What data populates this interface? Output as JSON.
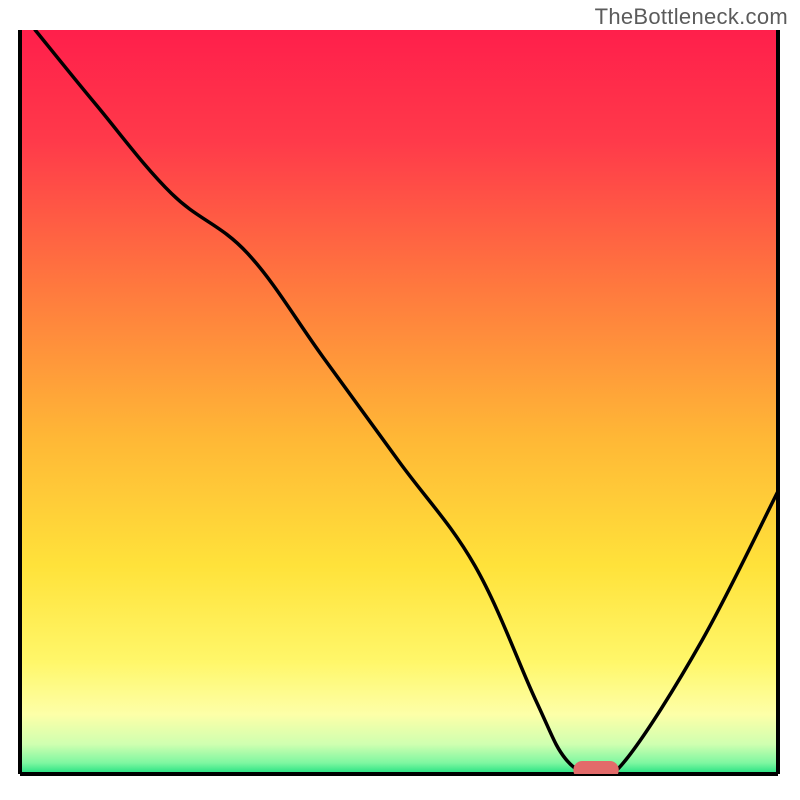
{
  "watermark": "TheBottleneck.com",
  "chart_data": {
    "type": "line",
    "title": "",
    "xlabel": "",
    "ylabel": "",
    "xlim": [
      0,
      100
    ],
    "ylim": [
      0,
      100
    ],
    "grid": false,
    "series": [
      {
        "name": "bottleneck-curve",
        "x": [
          2,
          10,
          20,
          30,
          40,
          50,
          60,
          68,
          72,
          76,
          80,
          90,
          100
        ],
        "y": [
          100,
          90,
          78,
          70,
          56,
          42,
          28,
          10,
          2,
          0,
          2,
          18,
          38
        ]
      }
    ],
    "marker": {
      "name": "optimal-range",
      "x_center": 76,
      "width": 6,
      "color": "#e36a6a"
    },
    "gradient_stops": [
      {
        "offset": 0.0,
        "color": "#ff1f4b"
      },
      {
        "offset": 0.15,
        "color": "#ff3a4a"
      },
      {
        "offset": 0.35,
        "color": "#ff7a3e"
      },
      {
        "offset": 0.55,
        "color": "#ffb836"
      },
      {
        "offset": 0.72,
        "color": "#ffe23a"
      },
      {
        "offset": 0.85,
        "color": "#fff76a"
      },
      {
        "offset": 0.92,
        "color": "#fdffa8"
      },
      {
        "offset": 0.96,
        "color": "#cfffb0"
      },
      {
        "offset": 0.985,
        "color": "#7ff7a1"
      },
      {
        "offset": 1.0,
        "color": "#1fe080"
      }
    ]
  }
}
